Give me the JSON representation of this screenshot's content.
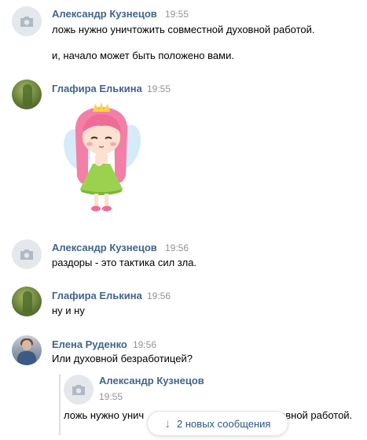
{
  "messages": [
    {
      "author": "Александр Кузнецов",
      "time": "19:55",
      "lines": [
        "ложь нужно уничтожить совместной духовной работой.",
        "и, начало может быть положено вами."
      ]
    },
    {
      "author": "Глафира Елькина",
      "time": "19:55",
      "sticker": "fairy-girl-sticker"
    },
    {
      "author": "Александр Кузнецов",
      "time": "19:56",
      "lines": [
        "раздоры - это тактика сил зла."
      ]
    },
    {
      "author": "Глафира Елькина",
      "time": "19:56",
      "lines": [
        "ну и ну"
      ]
    },
    {
      "author": "Елена Руденко",
      "time": "19:56",
      "lines": [
        "Или духовной безработицей?"
      ],
      "forwarded": {
        "author": "Александр Кузнецов",
        "time": "19:55",
        "text_left": "ложь нужно унич",
        "text_right": "овной работой."
      }
    }
  ],
  "new_messages_button": {
    "label": "2 новых сообщения",
    "icon": "arrow-down-icon"
  },
  "colors": {
    "author": "#42648b",
    "time": "#939393",
    "accent": "#2a5885"
  }
}
